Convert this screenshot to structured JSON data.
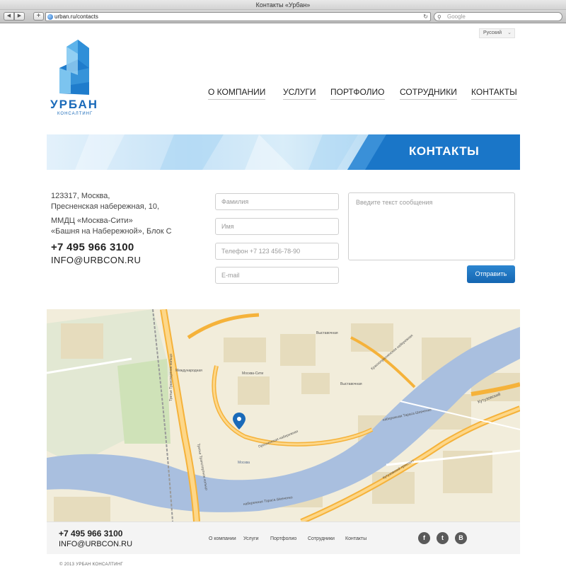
{
  "browser": {
    "window_title": "Контакты «Урбан»",
    "back_label": "◀",
    "forward_label": "▶",
    "add_label": "+",
    "url": "urban.ru/contacts",
    "reload_label": "↻",
    "search_placeholder": "Google"
  },
  "header": {
    "language": "Русский",
    "logo_text": "УРБАН",
    "logo_sub": "КОНСАЛТИНГ",
    "nav": [
      "О КОМПАНИИ",
      "УСЛУГИ",
      "ПОРТФОЛИО",
      "СОТРУДНИКИ",
      "КОНТАКТЫ"
    ]
  },
  "banner": {
    "title": "КОНТАКТЫ"
  },
  "contacts": {
    "address_lines": [
      "123317, Москва,",
      "Пресненская набережная, 10,"
    ],
    "building_lines": [
      "ММДЦ «Москва-Сити»",
      "«Башня на Набережной», Блок С"
    ],
    "phone": "+7 495 966 3100",
    "email": "INFO@URBCON.RU"
  },
  "form": {
    "lastname_placeholder": "Фамилия",
    "name_placeholder": "Имя",
    "phone_placeholder": "Телефон +7 123 456-78-90",
    "email_placeholder": "E-mail",
    "message_placeholder": "Введите текст сообщения",
    "submit_label": "Отправить"
  },
  "map": {
    "labels": {
      "moskva_city": "Москва-Сити",
      "vystavochnaya_1": "Выставочная",
      "vystavochnaya_2": "Выставочная",
      "mezhdunarodnaya": "Международная",
      "presnenskaya": "Пресненская набережная",
      "krasnopresnenskaya": "Краснопресненская набережная",
      "shevchenko_1": "набережная Тараса Шевченко",
      "shevchenko_2": "набережная Тараса Шевченко",
      "third_ring_1": "Третье Транспортное кольцо",
      "third_ring_2": "Третье Транспортное кольцо",
      "kutuzovsky": "Кутузовский",
      "kutuzovsky_prospekt": "Кутузовский проспект",
      "river": "Москва"
    }
  },
  "footer": {
    "phone": "+7 495 966 3100",
    "email": "INFO@URBCON.RU",
    "links": [
      "О компании",
      "Услуги",
      "Портфолио",
      "Сотрудники",
      "Контакты"
    ],
    "social": [
      "f",
      "t",
      "B"
    ],
    "copyright": "© 2013 УРБАН КОНСАЛТИНГ"
  }
}
